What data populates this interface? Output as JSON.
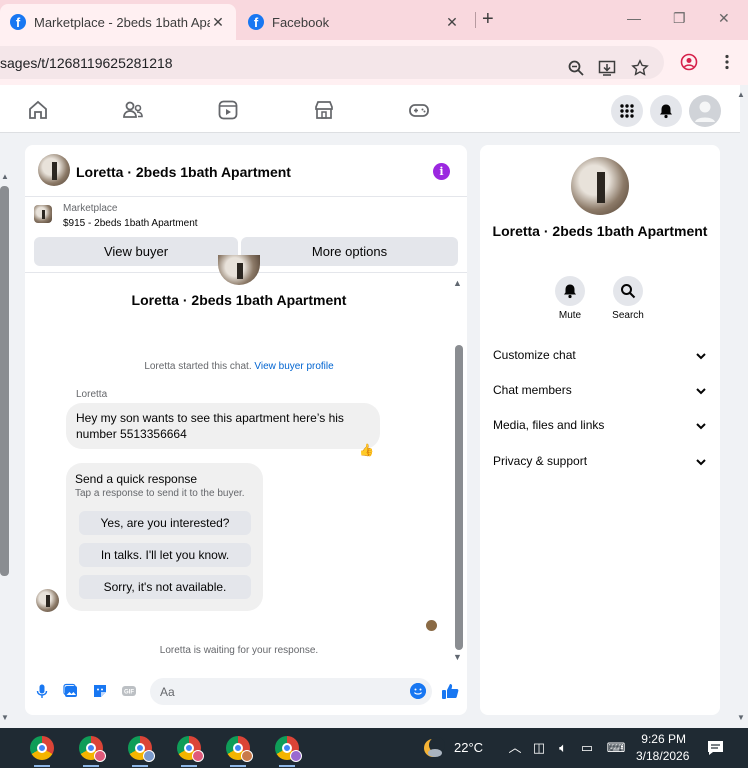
{
  "browser": {
    "tabs": [
      {
        "title": "Marketplace - 2beds 1bath Apa",
        "active": true
      },
      {
        "title": "Facebook",
        "active": false
      }
    ],
    "url": "sages/t/1268119625281218"
  },
  "chat": {
    "title": "Loretta · 2beds 1bath Apartment",
    "marketplace_label": "Marketplace",
    "listing": "$915 - 2beds 1bath Apartment",
    "view_buyer_label": "View buyer",
    "more_options_label": "More options",
    "center_name": "Loretta · 2beds 1bath Apartment",
    "started_text": "Loretta started this chat.",
    "view_profile_link": "View buyer profile",
    "sender": "Loretta",
    "message": "Hey my son wants to see this apartment here’s his number 5513356664",
    "reaction": "👍",
    "quick_title": "Send a quick response",
    "quick_sub": "Tap a response to send it to the buyer.",
    "quick_responses": [
      "Yes, are you interested?",
      "In talks. I'll let you know.",
      "Sorry, it's not available."
    ],
    "waiting_text": "Loretta is waiting for your response.",
    "composer_placeholder": "Aa",
    "gif_label": "GIF"
  },
  "side": {
    "name": "Loretta · 2beds 1bath Apartment",
    "actions": [
      {
        "label": "Mute",
        "icon": "bell-icon"
      },
      {
        "label": "Search",
        "icon": "search-icon"
      }
    ],
    "sections": [
      "Customize chat",
      "Chat members",
      "Media, files and links",
      "Privacy & support"
    ]
  },
  "taskbar": {
    "temperature": "22°C",
    "time": "9:26 PM",
    "date": "3/18/2026"
  },
  "colors": {
    "accent": "#1877f2",
    "info": "#9b27e0",
    "tab_strip": "#f9d8de"
  }
}
